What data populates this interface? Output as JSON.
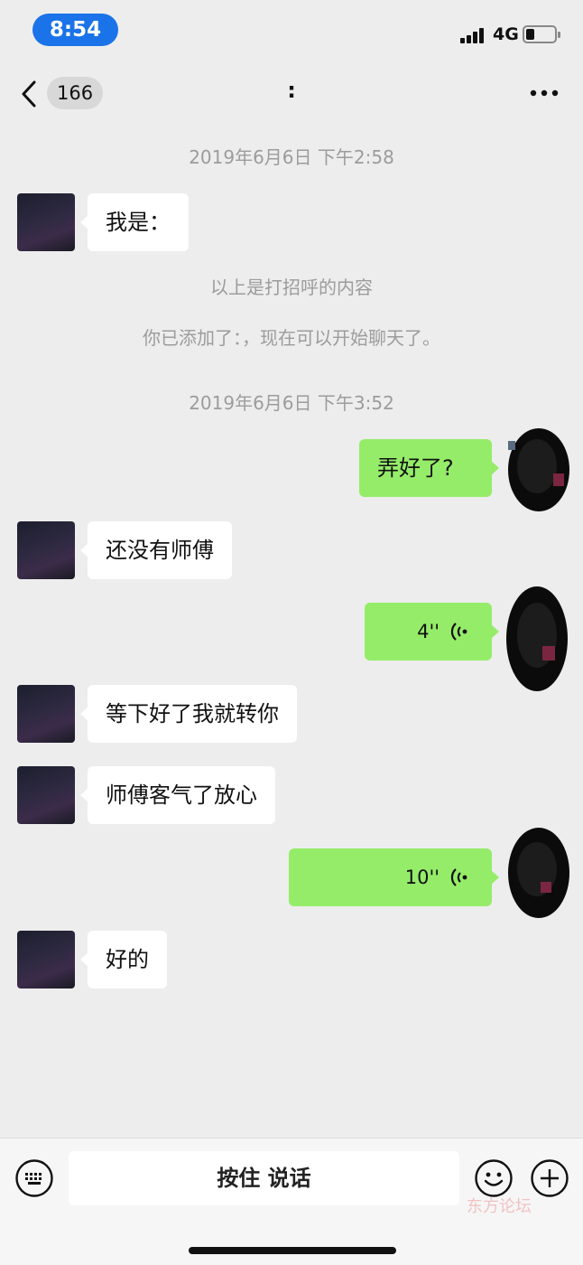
{
  "status_bar": {
    "time": "8:54",
    "network": "4G"
  },
  "nav": {
    "unread_count": "166",
    "title": ":"
  },
  "messages": [
    {
      "type": "timestamp",
      "text": "2019年6月6日 下午2:58"
    },
    {
      "type": "incoming",
      "text": "我是："
    },
    {
      "type": "system",
      "text": "以上是打招呼的内容"
    },
    {
      "type": "system",
      "text": "你已添加了：，现在可以开始聊天了。"
    },
    {
      "type": "timestamp",
      "text": "2019年6月6日 下午3:52"
    },
    {
      "type": "outgoing",
      "text": "弄好了?"
    },
    {
      "type": "incoming",
      "text": "还没有师傅"
    },
    {
      "type": "outgoing_voice",
      "duration": "4''"
    },
    {
      "type": "incoming",
      "text": "等下好了我就转你"
    },
    {
      "type": "incoming",
      "text": "师傅客气了放心"
    },
    {
      "type": "outgoing_voice",
      "duration": "10''"
    },
    {
      "type": "incoming",
      "text": "好的"
    }
  ],
  "input_bar": {
    "hold_to_talk": "按住 说话",
    "watermark": "东方论坛"
  },
  "icons": [
    "back-arrow-icon",
    "more-dots-icon",
    "keyboard-icon",
    "emoji-icon",
    "plus-icon",
    "voice-wave-icon"
  ],
  "colors": {
    "outgoing_bubble": "#95ec69",
    "incoming_bubble": "#ffffff",
    "background": "#ededed",
    "time_pill": "#1a73e8"
  }
}
